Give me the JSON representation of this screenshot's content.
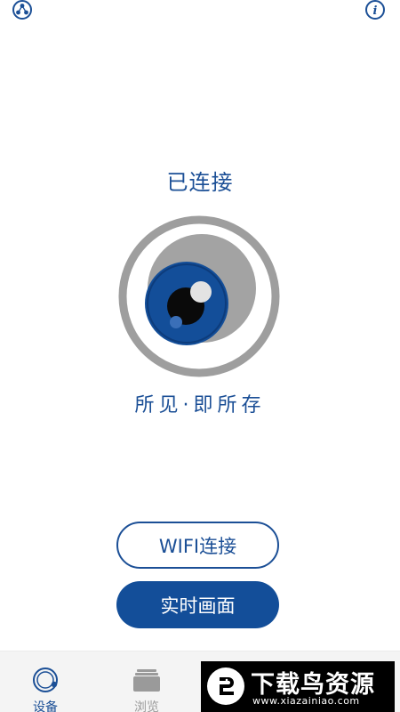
{
  "header": {
    "left_icon": "share-icon",
    "right_icon": "info-icon"
  },
  "main": {
    "status": "已连接",
    "slogan": "所见·即所存",
    "logo_icon": "eye-lens-logo"
  },
  "buttons": {
    "wifi_label": "WIFI连接",
    "live_label": "实时画面"
  },
  "tabbar": {
    "tabs": [
      {
        "label": "设备",
        "icon": "device-ring-icon",
        "active": true
      },
      {
        "label": "浏览",
        "icon": "album-stack-icon",
        "active": false
      }
    ]
  },
  "watermark": {
    "title": "下载鸟资源",
    "url": "www.xiazainiao.com"
  },
  "colors": {
    "primary": "#134e99",
    "text_blue": "#1b4f96",
    "ring_gray": "#9e9e9e",
    "tab_inactive": "#9a9a9a"
  }
}
